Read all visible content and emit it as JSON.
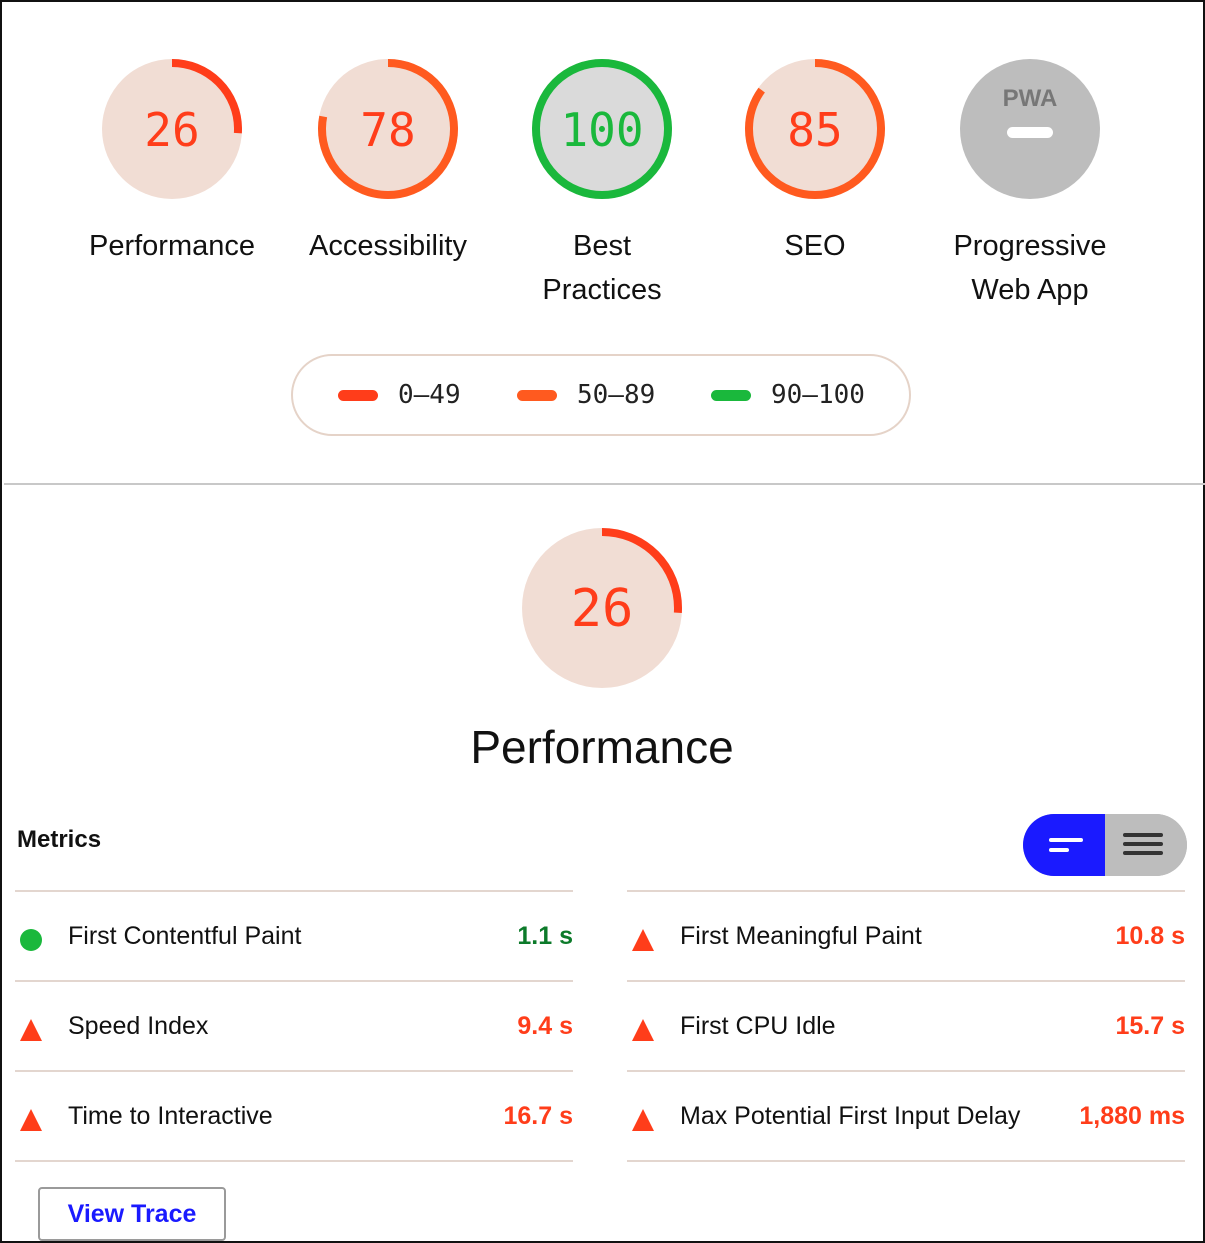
{
  "colors": {
    "fail": "#ff3d1a",
    "average": "#ff5a1f",
    "pass": "#1ab83c",
    "fail_fill": "#f1ddd4",
    "pass_fill": "#dadada",
    "pwa_fill": "#bdbdbd",
    "average_text": "#ff3d1a",
    "pass_text": "#0c7a2a",
    "accent_blue": "#1a1aff"
  },
  "gauges": [
    {
      "score": "26",
      "value": 26,
      "label": "Performance",
      "rating": "fail"
    },
    {
      "score": "78",
      "value": 78,
      "label": "Accessibility",
      "rating": "average"
    },
    {
      "score": "100",
      "value": 100,
      "label": "Best\nPractices",
      "rating": "pass"
    },
    {
      "score": "85",
      "value": 85,
      "label": "SEO",
      "rating": "average"
    },
    {
      "score": "PWA",
      "value": null,
      "label": "Progressive\nWeb App",
      "rating": "na"
    }
  ],
  "legend": [
    {
      "range": "0–49",
      "color": "#ff3d1a"
    },
    {
      "range": "50–89",
      "color": "#ff5a1f"
    },
    {
      "range": "90–100",
      "color": "#1ab83c"
    }
  ],
  "performance": {
    "score": "26",
    "value": 26,
    "title": "Performance"
  },
  "metrics": {
    "label": "Metrics",
    "left": [
      {
        "name": "First Contentful Paint",
        "value": "1.1 s",
        "status": "pass"
      },
      {
        "name": "Speed Index",
        "value": "9.4 s",
        "status": "fail"
      },
      {
        "name": "Time to Interactive",
        "value": "16.7 s",
        "status": "fail"
      }
    ],
    "right": [
      {
        "name": "First Meaningful Paint",
        "value": "10.8 s",
        "status": "fail"
      },
      {
        "name": "First CPU Idle",
        "value": "15.7 s",
        "status": "fail"
      },
      {
        "name": "Max Potential First Input Delay",
        "value": "1,880 ms",
        "status": "fail"
      }
    ]
  },
  "view_trace_label": "View Trace"
}
